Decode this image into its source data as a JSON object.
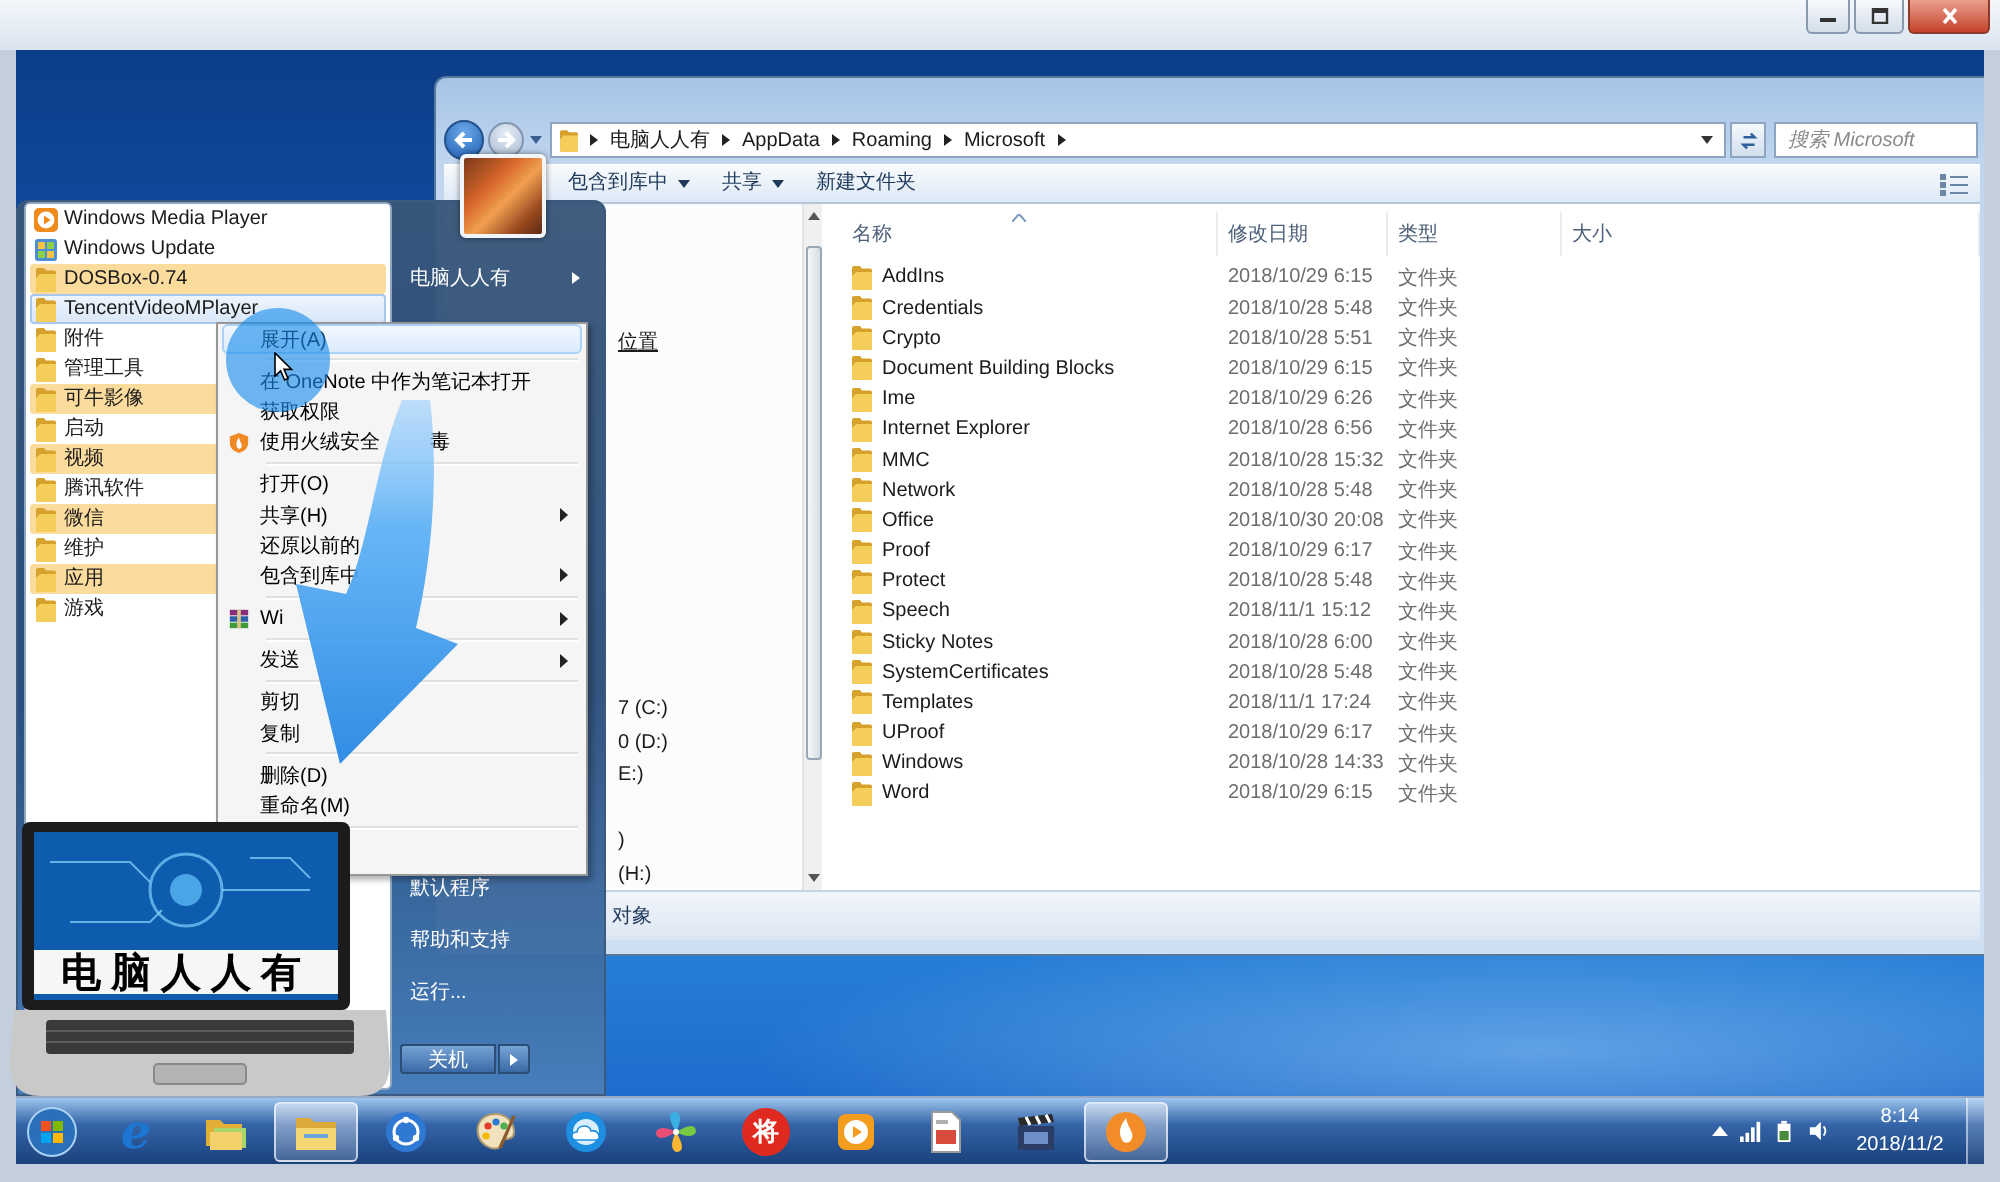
{
  "explorer": {
    "nav_buttons": [
      {
        "kind": "back",
        "disabled": false
      },
      {
        "kind": "forward",
        "disabled": true
      }
    ],
    "breadcrumb": [
      "电脑人人有",
      "AppData",
      "Roaming",
      "Microsoft"
    ],
    "search": {
      "placeholder": "搜索 Microsoft"
    },
    "toolbar": [
      {
        "label": "包含到库中",
        "dropdown": true
      },
      {
        "label": "共享",
        "dropdown": true
      },
      {
        "label": "新建文件夹",
        "dropdown": false
      }
    ],
    "nav_pane": [
      {
        "kind": "link",
        "label": "位置"
      },
      {
        "kind": "drive",
        "label": "7 (C:)"
      },
      {
        "kind": "drive",
        "label": "0 (D:)"
      },
      {
        "kind": "drive",
        "label": "E:)"
      },
      {
        "kind": "drive",
        "label": ")"
      },
      {
        "kind": "drive",
        "label": "(H:)"
      }
    ],
    "columns": [
      {
        "label": "名称",
        "sorted": true
      },
      {
        "label": "修改日期",
        "sorted": false
      },
      {
        "label": "类型",
        "sorted": false
      },
      {
        "label": "大小",
        "sorted": false
      }
    ],
    "files": [
      {
        "name": "AddIns",
        "modified": "2018/10/29 6:15",
        "type": "文件夹"
      },
      {
        "name": "Credentials",
        "modified": "2018/10/28 5:48",
        "type": "文件夹"
      },
      {
        "name": "Crypto",
        "modified": "2018/10/28 5:51",
        "type": "文件夹"
      },
      {
        "name": "Document Building Blocks",
        "modified": "2018/10/29 6:15",
        "type": "文件夹"
      },
      {
        "name": "Ime",
        "modified": "2018/10/29 6:26",
        "type": "文件夹"
      },
      {
        "name": "Internet Explorer",
        "modified": "2018/10/28 6:56",
        "type": "文件夹"
      },
      {
        "name": "MMC",
        "modified": "2018/10/28 15:32",
        "type": "文件夹"
      },
      {
        "name": "Network",
        "modified": "2018/10/28 5:48",
        "type": "文件夹"
      },
      {
        "name": "Office",
        "modified": "2018/10/30 20:08",
        "type": "文件夹"
      },
      {
        "name": "Proof",
        "modified": "2018/10/29 6:17",
        "type": "文件夹"
      },
      {
        "name": "Protect",
        "modified": "2018/10/28 5:48",
        "type": "文件夹"
      },
      {
        "name": "Speech",
        "modified": "2018/11/1 15:12",
        "type": "文件夹"
      },
      {
        "name": "Sticky Notes",
        "modified": "2018/10/28 6:00",
        "type": "文件夹"
      },
      {
        "name": "SystemCertificates",
        "modified": "2018/10/28 5:48",
        "type": "文件夹"
      },
      {
        "name": "Templates",
        "modified": "2018/11/1 17:24",
        "type": "文件夹"
      },
      {
        "name": "UProof",
        "modified": "2018/10/29 6:17",
        "type": "文件夹"
      },
      {
        "name": "Windows",
        "modified": "2018/10/28 14:33",
        "type": "文件夹"
      },
      {
        "name": "Word",
        "modified": "2018/10/29 6:15",
        "type": "文件夹"
      }
    ],
    "status": "对象"
  },
  "start_menu": {
    "programs": [
      {
        "name": "Windows Media Player",
        "kind": "wmp",
        "new": false,
        "selected": false
      },
      {
        "name": "Windows Update",
        "kind": "update",
        "new": false,
        "selected": false
      },
      {
        "name": "DOSBox-0.74",
        "kind": "folder",
        "new": true,
        "selected": false
      },
      {
        "name": "TencentVideoMPlayer",
        "kind": "folder",
        "new": false,
        "selected": true
      },
      {
        "name": "附件",
        "kind": "folder",
        "new": false,
        "selected": false
      },
      {
        "name": "管理工具",
        "kind": "folder",
        "new": false,
        "selected": false
      },
      {
        "name": "可牛影像",
        "kind": "folder",
        "new": true,
        "selected": false
      },
      {
        "name": "启动",
        "kind": "folder",
        "new": false,
        "selected": false
      },
      {
        "name": "视频",
        "kind": "folder",
        "new": true,
        "selected": false
      },
      {
        "name": "腾讯软件",
        "kind": "folder",
        "new": false,
        "selected": false
      },
      {
        "name": "微信",
        "kind": "folder",
        "new": true,
        "selected": false
      },
      {
        "name": "维护",
        "kind": "folder",
        "new": false,
        "selected": false
      },
      {
        "name": "应用",
        "kind": "folder",
        "new": true,
        "selected": false
      },
      {
        "name": "游戏",
        "kind": "folder",
        "new": false,
        "selected": false
      }
    ],
    "user_folder": "电脑人人有",
    "links": [
      "默认程序",
      "帮助和支持",
      "运行..."
    ],
    "shutdown": "关机"
  },
  "context_menu": [
    {
      "kind": "plain",
      "label": "展开(A)",
      "selected": true,
      "submenu": false
    },
    {
      "kind": "separator"
    },
    {
      "kind": "plain",
      "label": "在 OneNote 中作为笔记本打开",
      "selected": false,
      "submenu": false
    },
    {
      "kind": "plain",
      "label": "获取权限",
      "selected": false,
      "submenu": false
    },
    {
      "kind": "flame",
      "label": "使用火绒安全",
      "label_after": "毒",
      "selected": false,
      "submenu": false
    },
    {
      "kind": "separator"
    },
    {
      "kind": "plain",
      "label": "打开(O)",
      "selected": false,
      "submenu": false
    },
    {
      "kind": "plain",
      "label": "共享(H)",
      "selected": false,
      "submenu": true
    },
    {
      "kind": "plain",
      "label": "还原以前的",
      "selected": false,
      "submenu": false
    },
    {
      "kind": "plain",
      "label": "包含到库中",
      "selected": false,
      "submenu": true
    },
    {
      "kind": "separator"
    },
    {
      "kind": "archive",
      "label": "Wi",
      "selected": false,
      "submenu": true
    },
    {
      "kind": "separator"
    },
    {
      "kind": "plain",
      "label": "发送",
      "selected": false,
      "submenu": true
    },
    {
      "kind": "separator"
    },
    {
      "kind": "plain",
      "label": "剪切",
      "selected": false,
      "submenu": false
    },
    {
      "kind": "plain",
      "label": "复制",
      "selected": false,
      "submenu": false
    },
    {
      "kind": "separator"
    },
    {
      "kind": "plain",
      "label": "删除(D)",
      "selected": false,
      "submenu": false
    },
    {
      "kind": "plain",
      "label": "重命名(M)",
      "selected": false,
      "submenu": false
    },
    {
      "kind": "separator"
    }
  ],
  "logo": {
    "text": "电脑人人有"
  },
  "taskbar": {
    "items": [
      {
        "kind": "ie",
        "glyph": "e",
        "active": false
      },
      {
        "kind": "library",
        "active": false
      },
      {
        "kind": "explorer",
        "active": true
      },
      {
        "kind": "orbit",
        "active": false
      },
      {
        "kind": "palette",
        "active": false
      },
      {
        "kind": "cloud",
        "active": false
      },
      {
        "kind": "pinwheel",
        "active": false
      },
      {
        "kind": "badge",
        "glyph": "将",
        "active": false
      },
      {
        "kind": "player",
        "active": false
      },
      {
        "kind": "document",
        "active": false
      },
      {
        "kind": "clapper",
        "active": false
      },
      {
        "kind": "flame",
        "active": true
      }
    ],
    "clock": {
      "time": "8:14",
      "date": "2018/11/2"
    }
  }
}
